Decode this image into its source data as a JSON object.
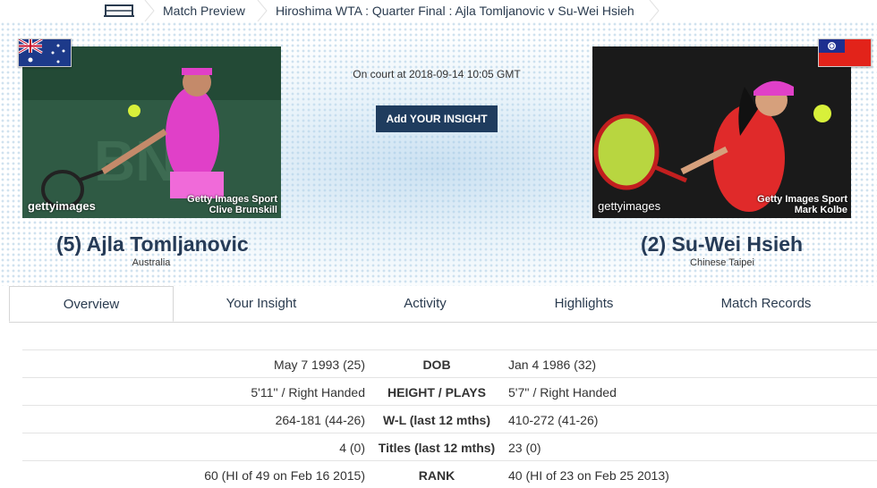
{
  "breadcrumb": {
    "items": [
      "Match Preview",
      "Hiroshima WTA : Quarter Final : Ajla Tomljanovic v Su-Wei Hsieh"
    ]
  },
  "match": {
    "court_time": "On court at 2018-09-14 10:05 GMT",
    "insight_button": "Add YOUR INSIGHT"
  },
  "player1": {
    "name": "(5) Ajla Tomljanovic",
    "country": "Australia",
    "photo_brand": "gettyimages",
    "photo_credit_line1": "Getty Images Sport",
    "photo_credit_line2": "Clive Brunskill",
    "flag_icon": "australia-flag-icon"
  },
  "player2": {
    "name": "(2) Su-Wei Hsieh",
    "country": "Chinese Taipei",
    "photo_brand": "gettyimages",
    "photo_credit_line1": "Getty Images Sport",
    "photo_credit_line2": "Mark Kolbe",
    "flag_icon": "taiwan-flag-icon"
  },
  "tabs": [
    {
      "label": "Overview",
      "active": true
    },
    {
      "label": "Your Insight",
      "active": false
    },
    {
      "label": "Activity",
      "active": false
    },
    {
      "label": "Highlights",
      "active": false
    },
    {
      "label": "Match Records",
      "active": false
    }
  ],
  "stats": [
    {
      "left": "May 7 1993 (25)",
      "label": "DOB",
      "right": "Jan 4 1986 (32)"
    },
    {
      "left": "5'11'' / Right Handed",
      "label": "HEIGHT / PLAYS",
      "right": "5'7'' / Right Handed"
    },
    {
      "left": "264-181 (44-26)",
      "label": "W-L (last 12 mths)",
      "right": "410-272 (41-26)"
    },
    {
      "left": "4 (0)",
      "label": "Titles (last 12 mths)",
      "right": "23 (0)"
    },
    {
      "left": "60 (HI of 49 on Feb 16 2015)",
      "label": "RANK",
      "right": "40 (HI of 23 on Feb 25 2013)"
    }
  ],
  "colors": {
    "accent": "#1f3c5e",
    "name": "#263b57",
    "player1_outfit": "#e040c8",
    "player2_outfit": "#e02a2a"
  }
}
